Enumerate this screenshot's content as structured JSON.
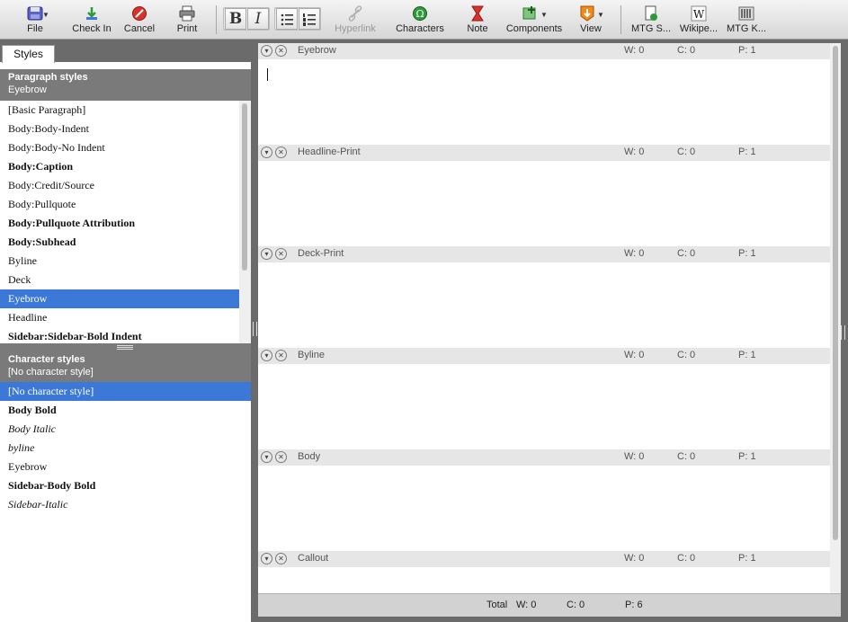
{
  "toolbar": {
    "file": "File",
    "check_in": "Check In",
    "cancel": "Cancel",
    "print": "Print",
    "bold": "B",
    "italic": "I",
    "hyperlink": "Hyperlink",
    "characters": "Characters",
    "note": "Note",
    "components": "Components",
    "view": "View",
    "bookmark1": "MTG S...",
    "bookmark2": "Wikipe...",
    "bookmark3": "MTG K...",
    "icons": [
      "file-icon",
      "check-in-icon",
      "cancel-icon",
      "print-icon",
      "bullet-list-icon",
      "numbered-list-icon",
      "hyperlink-icon",
      "characters-icon",
      "note-icon",
      "components-icon",
      "view-icon",
      "bookmark-icon",
      "wikipedia-icon",
      "library-icon"
    ]
  },
  "left_panel": {
    "tab": "Styles",
    "paragraph": {
      "title": "Paragraph styles",
      "current": "Eyebrow",
      "items": [
        {
          "label": "[Basic Paragraph]",
          "style": "normal"
        },
        {
          "label": "Body:Body-Indent",
          "style": "normal"
        },
        {
          "label": "Body:Body-No Indent",
          "style": "normal"
        },
        {
          "label": "Body:Caption",
          "style": "bold"
        },
        {
          "label": "Body:Credit/Source",
          "style": "normal"
        },
        {
          "label": "Body:Pullquote",
          "style": "normal"
        },
        {
          "label": "Body:Pullquote Attribution",
          "style": "bold"
        },
        {
          "label": "Body:Subhead",
          "style": "bold"
        },
        {
          "label": "Byline",
          "style": "normal"
        },
        {
          "label": "Deck",
          "style": "normal"
        },
        {
          "label": "Eyebrow",
          "style": "normal",
          "selected": true
        },
        {
          "label": "Headline",
          "style": "normal"
        },
        {
          "label": "Sidebar:Sidebar-Bold Indent",
          "style": "bold"
        }
      ]
    },
    "character": {
      "title": "Character styles",
      "current": "[No character style]",
      "items": [
        {
          "label": "[No character style]",
          "style": "normal",
          "selected": true
        },
        {
          "label": "Body Bold",
          "style": "bold"
        },
        {
          "label": "Body Italic",
          "style": "italic"
        },
        {
          "label": "byline",
          "style": "italic"
        },
        {
          "label": "Eyebrow",
          "style": "normal"
        },
        {
          "label": "Sidebar-Body Bold",
          "style": "bold"
        },
        {
          "label": "Sidebar-Italic",
          "style": "italic"
        }
      ]
    }
  },
  "editor": {
    "frames": [
      {
        "name": "Eyebrow",
        "w": "W:  0",
        "c": "C:  0",
        "p": "P:  1"
      },
      {
        "name": "Headline-Print",
        "w": "W:  0",
        "c": "C:  0",
        "p": "P:  1"
      },
      {
        "name": "Deck-Print",
        "w": "W:  0",
        "c": "C:  0",
        "p": "P:  1"
      },
      {
        "name": "Byline",
        "w": "W:  0",
        "c": "C:  0",
        "p": "P:  1"
      },
      {
        "name": "Body",
        "w": "W:  0",
        "c": "C:  0",
        "p": "P:  1"
      },
      {
        "name": "Callout",
        "w": "W:  0",
        "c": "C:  0",
        "p": "P:  1"
      }
    ],
    "frame_button_collapse": "▾",
    "frame_button_close": "✕"
  },
  "footer": {
    "total_label": "Total",
    "w": "W:  0",
    "c": "C:  0",
    "p": "P:  6"
  },
  "colors": {
    "selection": "#3b78d8",
    "section_header": "#7a7a7a",
    "cancel_red": "#d9322b",
    "check_green": "#2e9a3a"
  }
}
